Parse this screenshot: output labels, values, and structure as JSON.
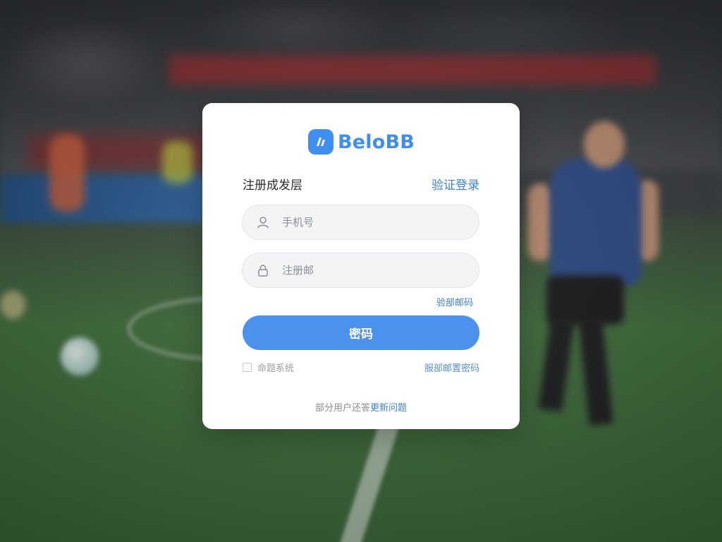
{
  "brand": {
    "name": "BeloBB",
    "accent_color": "#3f8ef0"
  },
  "form": {
    "heading": "注册成发层",
    "alt_login_link": "验证登录",
    "phone_field": {
      "placeholder": "手机号",
      "icon": "user-icon"
    },
    "password_field": {
      "placeholder": "注册邮",
      "icon": "lock-icon"
    },
    "get_code_link": "验部邮码",
    "submit_label": "密码",
    "agreement": {
      "checkbox_checked": false,
      "label": "命题系统",
      "link": "服部邮置密码"
    },
    "footer": {
      "text": "部分用户还答",
      "link": "更新问题"
    }
  },
  "background": {
    "description_icon": "stadium-photo"
  }
}
